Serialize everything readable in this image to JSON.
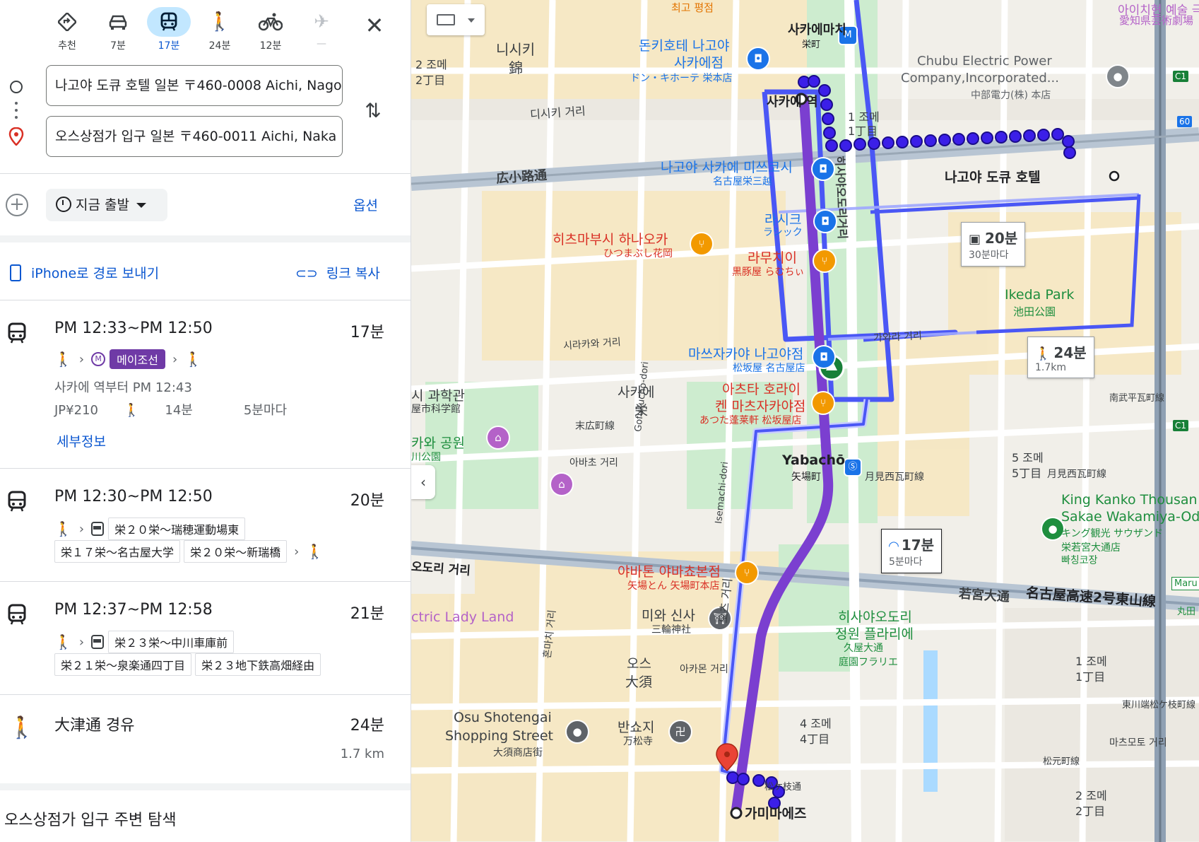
{
  "modes": [
    {
      "icon": "directions-icon",
      "label": "추천"
    },
    {
      "icon": "car-icon",
      "label": "7분"
    },
    {
      "icon": "transit-icon",
      "label": "17분",
      "active": true
    },
    {
      "icon": "walk-icon",
      "label": "24분"
    },
    {
      "icon": "bike-icon",
      "label": "12분"
    },
    {
      "icon": "flight-icon",
      "label": "—",
      "disabled": true
    }
  ],
  "origin": "나고야 도큐 호텔 일본 〒460-0008 Aichi, Nagoya",
  "destination": "오스상점가 입구 일본 〒460-0011 Aichi, Naka",
  "depart_label": "지금 출발",
  "options_label": "옵션",
  "share": {
    "send_label": "iPhone로 경로 보내기",
    "copy_label": "링크 복사"
  },
  "trips": [
    {
      "time": "PM 12:33~PM 12:50",
      "duration": "17분",
      "line": "메이조선",
      "from": "사카에 역부터 PM 12:43",
      "fare": "JP¥210",
      "walk": "14분",
      "freq": "5분마다",
      "details": "세부정보"
    },
    {
      "time": "PM 12:30~PM 12:50",
      "duration": "20분",
      "bus1": "栄２０栄～瑞穂運動場東",
      "bus2": "栄１７栄～名古屋大学",
      "bus3": "栄２０栄～新瑞橋"
    },
    {
      "time": "PM 12:37~PM 12:58",
      "duration": "21분",
      "bus1": "栄２３栄～中川車庫前",
      "bus2": "栄２１栄～泉楽通四丁目",
      "bus3": "栄２３地下鉄高畑経由"
    },
    {
      "time": "大津通 경유",
      "duration": "24분",
      "distance": "1.7 km"
    }
  ],
  "explore": "오스상점가 입구 주변 탐색",
  "map": {
    "callouts": {
      "bus": {
        "dur": "20분",
        "freq": "30분마다"
      },
      "walk": {
        "dur": "24분",
        "dist": "1.7km"
      },
      "transit": {
        "dur": "17분",
        "freq": "5분마다"
      }
    },
    "labels": {
      "tokyu_hotel": "나고야 도큐 호텔",
      "sakae_sta": "사카에 역",
      "sakae_machi": "사카에마치",
      "sakae_machi_jp": "栄町",
      "kamimaezu": "가미마에즈",
      "yabacho": "Yabachō",
      "yabacho_jp": "矢場町",
      "ikeda": "Ikeda Park",
      "ikeda_jp": "池田公園",
      "nishiki_kr": "니시키",
      "nishiki_jp": "錦",
      "sakae_kr": "사카에",
      "sakae_jp": "栄",
      "donki": "돈키호테 나고야",
      "donki2": "사카에점",
      "donki_jp": "ドン・キホーテ 栄本店",
      "mitsukoshi": "나고야 사카에 미쓰코시",
      "mitsukoshi_jp": "名古屋栄三越",
      "lachic": "라시크",
      "lachic_jp": "ラシック",
      "hitsumabushi": "히츠마부시 하나오카",
      "hitsumabushi_jp": "ひつまぶし花岡",
      "ramuchi": "라무치이",
      "ramuchi_jp": "黒豚屋 らむちぃ",
      "matsuzakaya": "마쓰자카야 나고야점",
      "matsuzakaya_jp": "松坂屋 名古屋店",
      "atsuta1": "아츠타 호라이",
      "atsuta2": "켄 마츠자카야점",
      "atsuta_jp": "あつた蓬莱軒 松坂屋店",
      "yabaton": "야바톤 야바쵸본점",
      "yabaton_jp": "矢場とん 矢場町本店",
      "misa": "미와 신사",
      "misa_jp": "三輪神社",
      "osu_kr": "오스",
      "osu_kr2": "大須",
      "osu_st1": "Osu Shotengai",
      "osu_st2": "Shopping Street",
      "osu_st_jp": "大須商店街",
      "bansho": "반쇼지",
      "bansho_jp": "万松寺",
      "hisaya_park1": "히사야오도리",
      "hisaya_park2": "정원 플라리에",
      "hisaya_park_jp1": "久屋大通",
      "hisaya_park_jp2": "庭園フラリエ",
      "chubu1": "Chubu Electric Power",
      "chubu2": "Company,Incorporated...",
      "chubu_jp": "中部電力(株) 本店",
      "aichi_arts": "아이치현 예술 극장",
      "aichi_arts_jp": "愛知県芸術劇場",
      "king1": "King Kanko Thousan",
      "king2": "Sakae Wakamiya-Od",
      "king_jp1": "キング観光 サウザンド",
      "king_jp2": "栄若宮大通店",
      "king_kr": "빠칭코장",
      "science": "시 과학관",
      "science_jp": "屋市科学館",
      "shirakawa": "카와 공원",
      "shirakawa_jp": "川公園",
      "electric": "ctric Lady Land",
      "hirokoji": "広小路通",
      "dishiki": "디시키 거리",
      "shirakawa_dori": "시라카와 거리",
      "suehiro": "末広町線",
      "abacho": "아바초 거리",
      "gofukucho": "Gofukucho-dori",
      "isemachi": "Isemachi-dori",
      "wakamiya": "若宮大通",
      "nagoya_exp": "名古屋高速2号東山線",
      "otsu": "오츠 거리",
      "ohdori": "오도리 거리",
      "hisaya_st": "히사야오도리거리",
      "nishiki2": "2 조메",
      "nishiki2b": "2丁目",
      "sakae1": "1 조메",
      "sakae1b": "1丁目",
      "sakae5": "5 조메",
      "sakae5b": "5丁目",
      "osu4": "4 조메",
      "osu4b": "4丁目",
      "osu1": "1 조메",
      "osu1b": "1丁目",
      "osu2": "2 조메",
      "osu2b": "2丁目",
      "tsukimi": "月見西瓦町線",
      "tsukimi2": "月見西瓦町線",
      "nanbu": "南武平瓦町線",
      "matsugae": "松ケ枝通",
      "matsumoto": "松元町線",
      "higashi": "東川端松ケ枝町線",
      "masaki": "마츠모토 거리",
      "hongan": "혼마치 거리",
      "kitamura": "가와라 거리",
      "hisayaodori_kr": "히사야오도리거리",
      "akamon": "아카몬 거리",
      "sakai": "사카에 역",
      "saikou": "최고 평점",
      "c1": "C1",
      "r60": "60",
      "maru": "Maru",
      "maru_jp": "丸田"
    }
  }
}
